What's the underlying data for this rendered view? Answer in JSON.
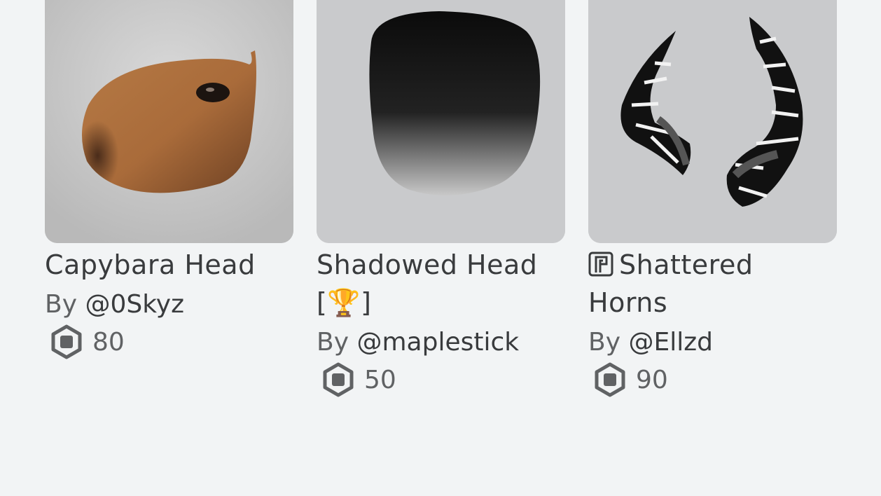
{
  "items": [
    {
      "name": "Capybara Head",
      "by_prefix": "By",
      "creator": "@0Skyz",
      "price": "80",
      "limited": false
    },
    {
      "name": "Shadowed Head [🏆]",
      "by_prefix": "By",
      "creator": "@maplestick",
      "price": "50",
      "limited": false
    },
    {
      "name": "Shattered Horns",
      "by_prefix": "By",
      "creator": "@Ellzd",
      "price": "90",
      "limited": true
    }
  ],
  "icons": {
    "currency": "robux-icon",
    "limited": "limited-icon"
  },
  "colors": {
    "page_bg": "#f2f4f5",
    "thumb_bg": "#c9cacc",
    "text_primary": "#393b3d",
    "text_secondary": "#606264"
  }
}
